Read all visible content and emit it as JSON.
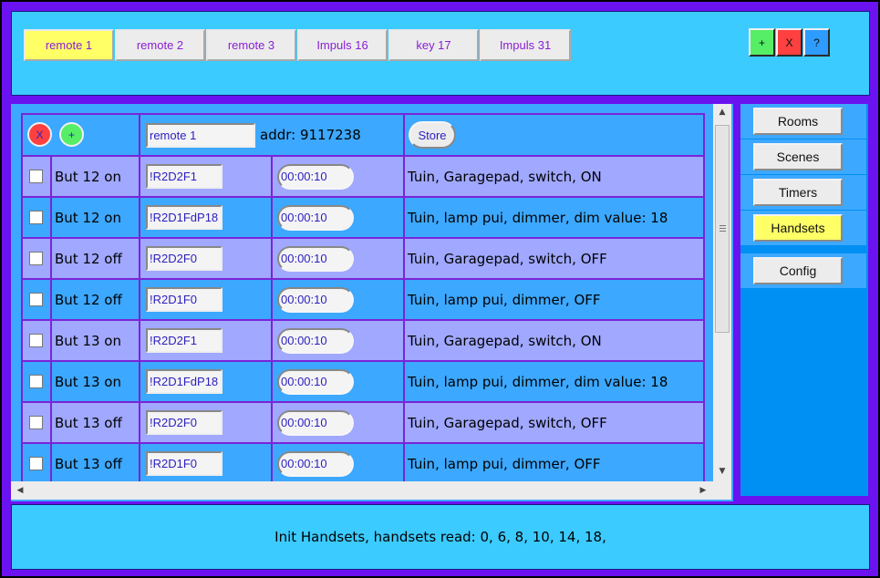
{
  "tabs": [
    {
      "label": "remote 1",
      "active": true
    },
    {
      "label": "remote 2",
      "active": false
    },
    {
      "label": "remote 3",
      "active": false
    },
    {
      "label": "Impuls 16",
      "active": false
    },
    {
      "label": "key 17",
      "active": false
    },
    {
      "label": "Impuls 31",
      "active": false
    }
  ],
  "top_buttons": {
    "add": "+",
    "close": "X",
    "help": "?"
  },
  "header": {
    "remove": "X",
    "add": "+",
    "name_value": "remote 1",
    "addr_label": "addr: 9117238",
    "store": "Store"
  },
  "rows": [
    {
      "label": "But 12 on",
      "code": "!R2D2F1",
      "time": "00:00:10",
      "desc": "Tuin, Garagepad, switch, ON"
    },
    {
      "label": "But 12 on",
      "code": "!R2D1FdP18",
      "time": "00:00:10",
      "desc": "Tuin, lamp pui, dimmer, dim value: 18"
    },
    {
      "label": "But 12 off",
      "code": "!R2D2F0",
      "time": "00:00:10",
      "desc": "Tuin, Garagepad, switch, OFF"
    },
    {
      "label": "But 12 off",
      "code": "!R2D1F0",
      "time": "00:00:10",
      "desc": "Tuin, lamp pui, dimmer, OFF"
    },
    {
      "label": "But 13 on",
      "code": "!R2D2F1",
      "time": "00:00:10",
      "desc": "Tuin, Garagepad, switch, ON"
    },
    {
      "label": "But 13 on",
      "code": "!R2D1FdP18",
      "time": "00:00:10",
      "desc": "Tuin, lamp pui, dimmer, dim value: 18"
    },
    {
      "label": "But 13 off",
      "code": "!R2D2F0",
      "time": "00:00:10",
      "desc": "Tuin, Garagepad, switch, OFF"
    },
    {
      "label": "But 13 off",
      "code": "!R2D1F0",
      "time": "00:00:10",
      "desc": "Tuin, lamp pui, dimmer, OFF"
    }
  ],
  "sidebar": {
    "items": [
      {
        "label": "Rooms",
        "active": false
      },
      {
        "label": "Scenes",
        "active": false
      },
      {
        "label": "Timers",
        "active": false
      },
      {
        "label": "Handsets",
        "active": true
      },
      {
        "label": "Config",
        "active": false
      }
    ]
  },
  "status": "Init Handsets, handsets read: 0, 6, 8, 10, 14, 18,",
  "colors": {
    "frame": "#6b12f0",
    "panel": "#3ccbff",
    "row_light": "#a0a8ff",
    "row_blue": "#3ca8ff",
    "active_yellow": "#ffff66",
    "sidebar": "#008ff3",
    "add_green": "#55ee66",
    "close_red": "#ff4040",
    "help_blue": "#2e9bff"
  }
}
